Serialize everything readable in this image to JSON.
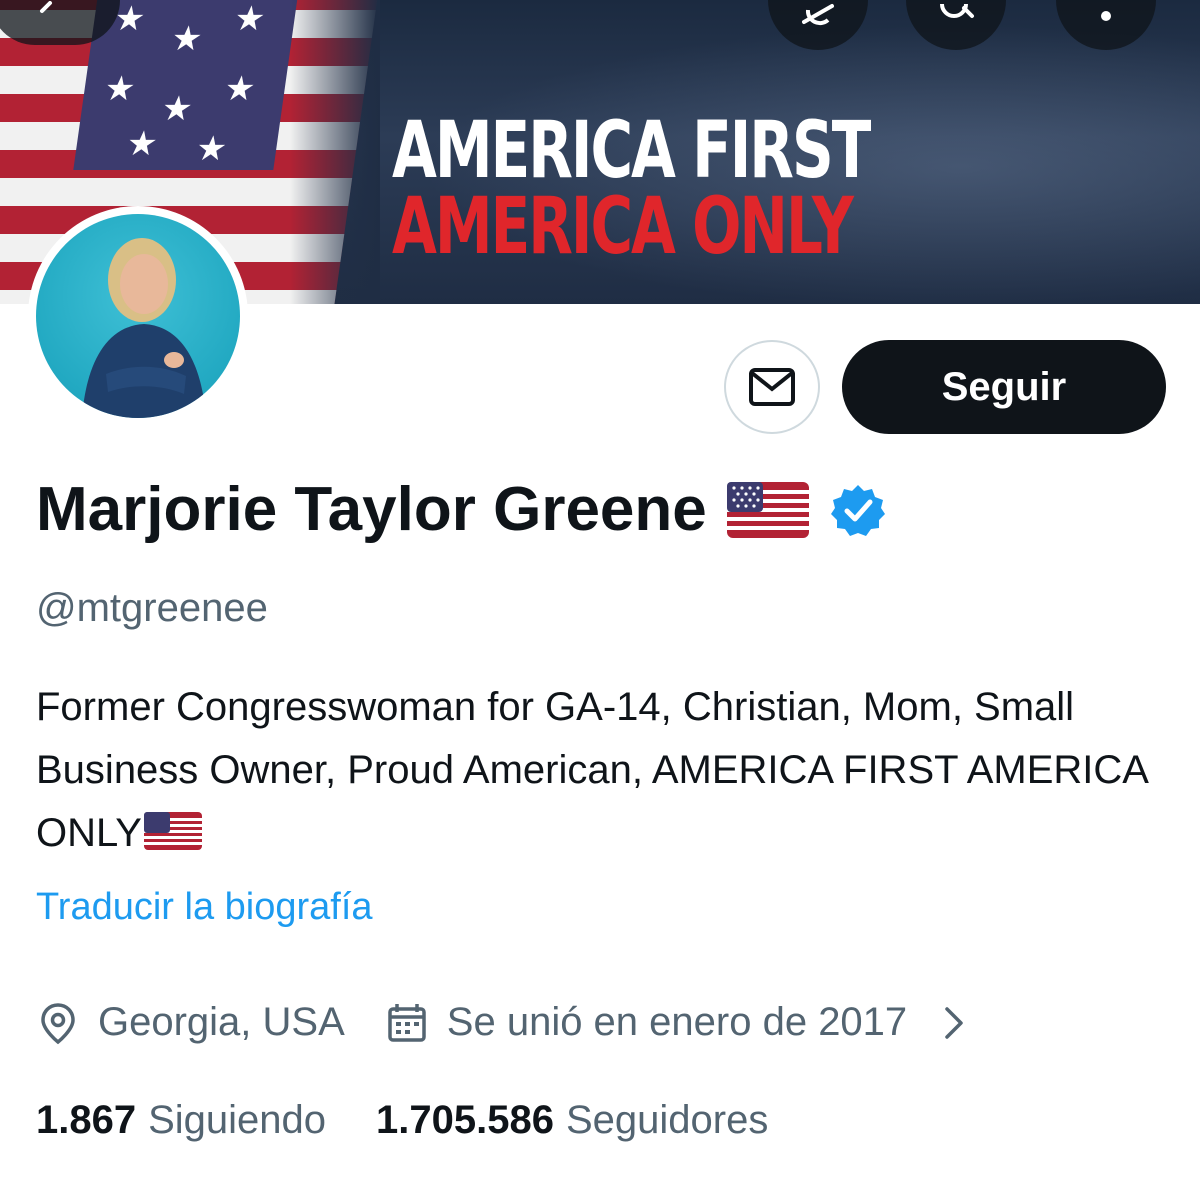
{
  "banner": {
    "line1": "AMERICA FIRST",
    "line2": "AMERICA ONLY"
  },
  "top_buttons": {
    "back_icon": "arrow-left-icon",
    "grok_icon": "grok-icon",
    "search_icon": "search-icon",
    "more_icon": "more-vertical-icon"
  },
  "actions": {
    "message_icon": "mail-icon",
    "follow_label": "Seguir"
  },
  "profile": {
    "name": "Marjorie Taylor Greene",
    "name_emoji_icon": "us-flag-icon",
    "verified_icon": "verified-badge-icon",
    "handle": "@mtgreenee",
    "bio": "Former Congresswoman for GA-14, Christian, Mom, Small Business Owner, Proud American, AMERICA FIRST AMERICA ONLY",
    "translate_link": "Traducir la biografía",
    "location": "Georgia, USA",
    "joined": "Se unió en enero de 2017",
    "following_count": "1.867",
    "following_label": "Siguiendo",
    "followers_count": "1.705.586",
    "followers_label": "Seguidores"
  },
  "colors": {
    "accent": "#1d9bf0",
    "text_primary": "#0f1419",
    "text_secondary": "#536471",
    "banner_red": "#e0262b"
  }
}
